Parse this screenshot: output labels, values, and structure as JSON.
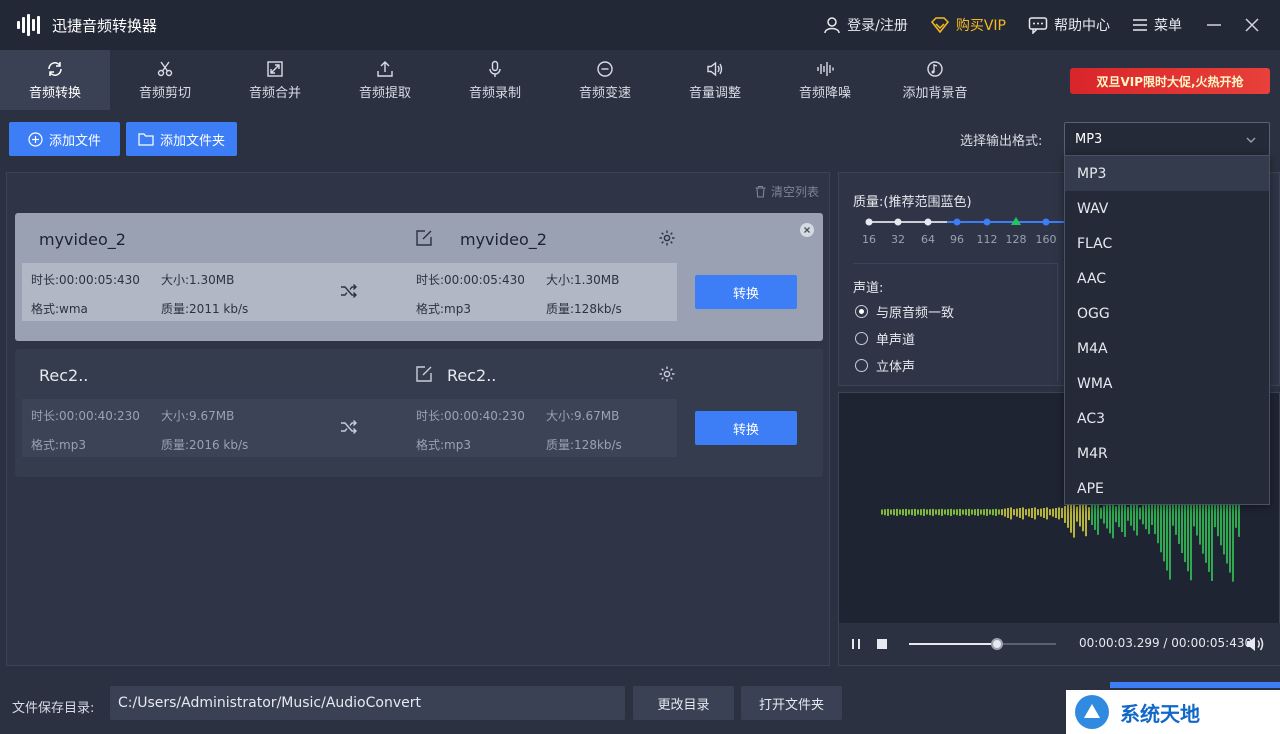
{
  "app": {
    "title": "迅捷音频转换器"
  },
  "titlebar": {
    "login": "登录/注册",
    "vip": "购买VIP",
    "help": "帮助中心",
    "menu": "菜单"
  },
  "tabs": [
    {
      "label": "音频转换",
      "icon": "refresh-icon",
      "active": true
    },
    {
      "label": "音频剪切",
      "icon": "scissors-icon"
    },
    {
      "label": "音频合并",
      "icon": "merge-icon"
    },
    {
      "label": "音频提取",
      "icon": "upload-icon"
    },
    {
      "label": "音频录制",
      "icon": "microphone-icon"
    },
    {
      "label": "音频变速",
      "icon": "speed-icon"
    },
    {
      "label": "音量调整",
      "icon": "volume-icon"
    },
    {
      "label": "音频降噪",
      "icon": "noise-icon"
    },
    {
      "label": "添加背景音",
      "icon": "music-icon"
    }
  ],
  "promo": {
    "text": "双旦VIP限时大促,火热开抢"
  },
  "actions": {
    "add_file": "添加文件",
    "add_folder": "添加文件夹",
    "format_label": "选择输出格式:",
    "format_value": "MP3"
  },
  "list": {
    "clear": "清空列表",
    "convert_label": "转换",
    "items": [
      {
        "name": "myvideo_2",
        "out_name": "myvideo_2",
        "src": {
          "duration": "时长:00:00:05:430",
          "size": "大小:1.30MB",
          "format": "格式:wma",
          "quality": "质量:2011 kb/s"
        },
        "dst": {
          "duration": "时长:00:00:05:430",
          "size": "大小:1.30MB",
          "format": "格式:mp3",
          "quality": "质量:128kb/s"
        }
      },
      {
        "name": "Rec2..",
        "out_name": "Rec2..",
        "src": {
          "duration": "时长:00:00:40:230",
          "size": "大小:9.67MB",
          "format": "格式:mp3",
          "quality": "质量:2016 kb/s"
        },
        "dst": {
          "duration": "时长:00:00:40:230",
          "size": "大小:9.67MB",
          "format": "格式:mp3",
          "quality": "质量:128kb/s"
        }
      }
    ]
  },
  "settings": {
    "quality_label": "质量:(推荐范围蓝色)",
    "quality_ticks": [
      "16",
      "32",
      "64",
      "96",
      "112",
      "128",
      "160"
    ],
    "channel_label": "声道:",
    "channels": [
      "与原音频一致",
      "单声道",
      "立体声"
    ],
    "channel_selected": 0
  },
  "player": {
    "time": "00:00:03.299 / 00:00:05:430",
    "progress": 0.6
  },
  "dropdown": {
    "options": [
      "MP3",
      "WAV",
      "FLAC",
      "AAC",
      "OGG",
      "M4A",
      "WMA",
      "AC3",
      "M4R",
      "APE"
    ],
    "highlighted": 0
  },
  "bottom": {
    "save_label": "文件保存目录:",
    "path": "C:/Users/Administrator/Music/AudioConvert",
    "change_dir": "更改目录",
    "open_folder": "打开文件夹"
  },
  "watermark": {
    "text": "系统天地"
  }
}
